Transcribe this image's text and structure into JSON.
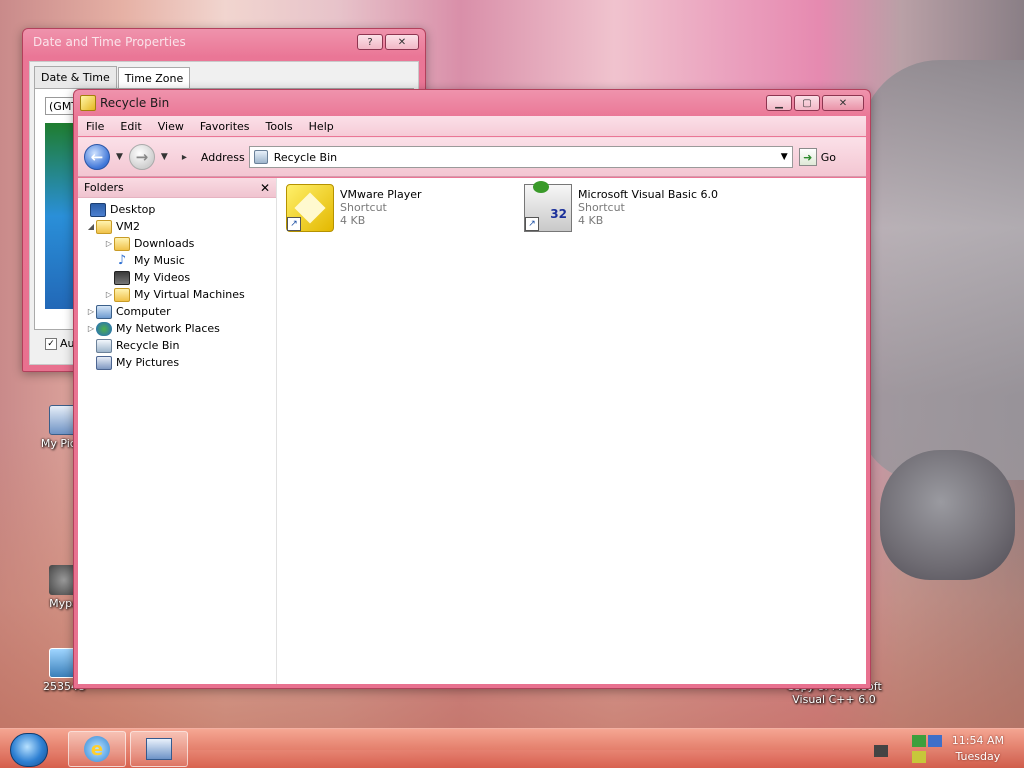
{
  "desktop": {
    "icons": [
      {
        "label": "My Pictu",
        "name": "my-pictures"
      },
      {
        "label": "Mypa",
        "name": "mypal"
      },
      {
        "label": "253548",
        "name": "253548"
      },
      {
        "label": "Copy of Microsoft Visual C++ 6.0",
        "name": "copy-of-vcpp"
      }
    ]
  },
  "date_time_window": {
    "title": "Date and Time Properties",
    "tabs": [
      "Date & Time",
      "Time Zone"
    ],
    "active_tab": "Time Zone",
    "timezone_value": "(GMT",
    "auto_label": "Au",
    "auto_checked": true
  },
  "recycle_window": {
    "title": "Recycle Bin",
    "menu": [
      "File",
      "Edit",
      "View",
      "Favorites",
      "Tools",
      "Help"
    ],
    "address_label": "Address",
    "address_value": "Recycle Bin",
    "go_label": "Go",
    "folders_title": "Folders",
    "tree": [
      {
        "label": "Desktop",
        "icon": "desktop-icon",
        "level": 0,
        "expander": ""
      },
      {
        "label": "VM2",
        "icon": "folder-icon",
        "level": 1,
        "expander": "◢"
      },
      {
        "label": "Downloads",
        "icon": "folder-icon",
        "level": 2,
        "expander": "▷"
      },
      {
        "label": "My Music",
        "icon": "music-note-icon",
        "level": 2,
        "expander": ""
      },
      {
        "label": "My Videos",
        "icon": "film-icon",
        "level": 2,
        "expander": ""
      },
      {
        "label": "My Virtual Machines",
        "icon": "folder-icon",
        "level": 2,
        "expander": "▷"
      },
      {
        "label": "Computer",
        "icon": "computer-icon",
        "level": 1,
        "expander": "▷"
      },
      {
        "label": "My Network Places",
        "icon": "network-icon",
        "level": 1,
        "expander": "▷"
      },
      {
        "label": "Recycle Bin",
        "icon": "recycle-bin-icon",
        "level": 1,
        "expander": ""
      },
      {
        "label": "My Pictures",
        "icon": "pictures-icon",
        "level": 1,
        "expander": ""
      }
    ],
    "files": [
      {
        "name": "VMware Player",
        "type": "Shortcut",
        "size": "4 KB",
        "icon": "vmware-player-icon"
      },
      {
        "name": "Microsoft Visual Basic 6.0",
        "type": "Shortcut",
        "size": "4 KB",
        "icon": "visual-basic-icon",
        "badge": "32"
      }
    ]
  },
  "taskbar": {
    "clock_time": "11:54 AM",
    "clock_day": "Tuesday"
  }
}
